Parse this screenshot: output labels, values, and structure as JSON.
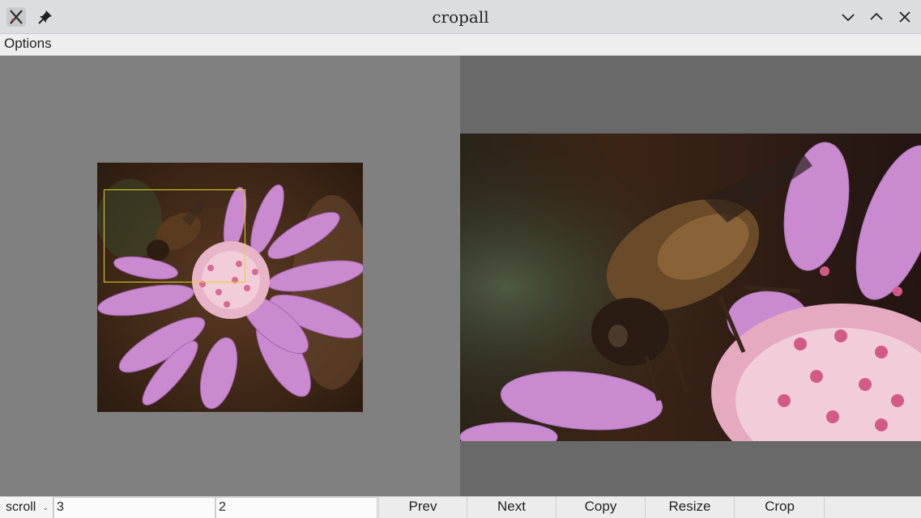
{
  "window": {
    "title": "cropall",
    "app_icon": "x-app-icon",
    "pin_icon": "pin-icon",
    "controls": [
      "minimize-chevron-icon",
      "maximize-chevron-icon",
      "close-icon"
    ]
  },
  "menu": {
    "options_label": "Options"
  },
  "toolbar": {
    "mode": "scroll",
    "field_one": "3",
    "field_two": "2",
    "prev_label": "Prev",
    "next_label": "Next",
    "copy_label": "Copy",
    "resize_label": "Resize",
    "crop_label": "Crop"
  },
  "colors": {
    "left_pane_bg": "#808080",
    "right_pane_bg": "#696969",
    "crop_rect": "#e3d21c"
  }
}
